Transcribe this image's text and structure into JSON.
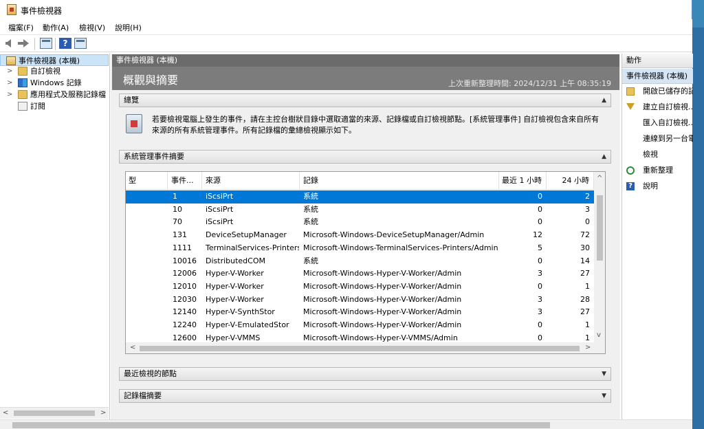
{
  "window": {
    "title": "事件檢視器"
  },
  "menu": [
    "檔案(F)",
    "動作(A)",
    "檢視(V)",
    "說明(H)"
  ],
  "tree": {
    "items": [
      {
        "label": "事件檢視器 (本機)",
        "expander": "",
        "icon": "event-viewer-icon"
      },
      {
        "label": "自訂檢視",
        "expander": ">",
        "icon": "folder-icon"
      },
      {
        "label": "Windows 記錄",
        "expander": ">",
        "icon": "windows-log-icon"
      },
      {
        "label": "應用程式及服務記錄檔",
        "expander": ">",
        "icon": "folder-icon"
      },
      {
        "label": "訂閱",
        "expander": "",
        "icon": "subscription-icon"
      }
    ]
  },
  "center": {
    "header": "事件檢視器 (本機)",
    "overview_title": "概觀與摘要",
    "last_refresh": "上次重新整理時間: 2024/12/31 上午 08:35:19",
    "summary_section": "總覽",
    "summary_text": "若要檢視電腦上發生的事件，請在主控台樹狀目錄中選取適當的來源、記錄檔或自訂檢視節點。[系統管理事件] 自訂檢視包含來自所有來源的所有系統管理事件。所有記錄檔的彙總檢視顯示如下。",
    "admin_section": "系統管理事件摘要",
    "recent_section": "最近檢視的節點",
    "logsummary_section": "記錄檔摘要"
  },
  "table": {
    "columns": [
      "型",
      "事件...",
      "來源",
      "記錄",
      "最近 1 小時",
      "24 小時"
    ],
    "rows": [
      {
        "id": "1",
        "source": "iScsiPrt",
        "log": "系統",
        "hour": "0",
        "day": "2"
      },
      {
        "id": "10",
        "source": "iScsiPrt",
        "log": "系統",
        "hour": "0",
        "day": "3"
      },
      {
        "id": "70",
        "source": "iScsiPrt",
        "log": "系統",
        "hour": "0",
        "day": "0"
      },
      {
        "id": "131",
        "source": "DeviceSetupManager",
        "log": "Microsoft-Windows-DeviceSetupManager/Admin",
        "hour": "12",
        "day": "72"
      },
      {
        "id": "1111",
        "source": "TerminalServices-Printers",
        "log": "Microsoft-Windows-TerminalServices-Printers/Admin",
        "hour": "5",
        "day": "30"
      },
      {
        "id": "10016",
        "source": "DistributedCOM",
        "log": "系統",
        "hour": "0",
        "day": "14"
      },
      {
        "id": "12006",
        "source": "Hyper-V-Worker",
        "log": "Microsoft-Windows-Hyper-V-Worker/Admin",
        "hour": "3",
        "day": "27"
      },
      {
        "id": "12010",
        "source": "Hyper-V-Worker",
        "log": "Microsoft-Windows-Hyper-V-Worker/Admin",
        "hour": "0",
        "day": "1"
      },
      {
        "id": "12030",
        "source": "Hyper-V-Worker",
        "log": "Microsoft-Windows-Hyper-V-Worker/Admin",
        "hour": "3",
        "day": "28"
      },
      {
        "id": "12140",
        "source": "Hyper-V-SynthStor",
        "log": "Microsoft-Windows-Hyper-V-Worker/Admin",
        "hour": "3",
        "day": "27"
      },
      {
        "id": "12240",
        "source": "Hyper-V-EmulatedStor",
        "log": "Microsoft-Windows-Hyper-V-Worker/Admin",
        "hour": "0",
        "day": "1"
      },
      {
        "id": "12600",
        "source": "Hyper-V-VMMS",
        "log": "Microsoft-Windows-Hyper-V-VMMS/Admin",
        "hour": "0",
        "day": "1"
      }
    ]
  },
  "actions": {
    "header": "動作",
    "subheader": "事件檢視器 (本機)",
    "items": [
      {
        "label": "開啟已儲存的記",
        "icon": "open-folder-icon"
      },
      {
        "label": "建立自訂檢視...",
        "icon": "filter-icon"
      },
      {
        "label": "匯入自訂檢視...",
        "icon": ""
      },
      {
        "label": "連線到另一台電",
        "icon": ""
      },
      {
        "label": "檢視",
        "icon": ""
      },
      {
        "label": "重新整理",
        "icon": "refresh-icon"
      },
      {
        "label": "說明",
        "icon": "help-icon"
      }
    ]
  }
}
